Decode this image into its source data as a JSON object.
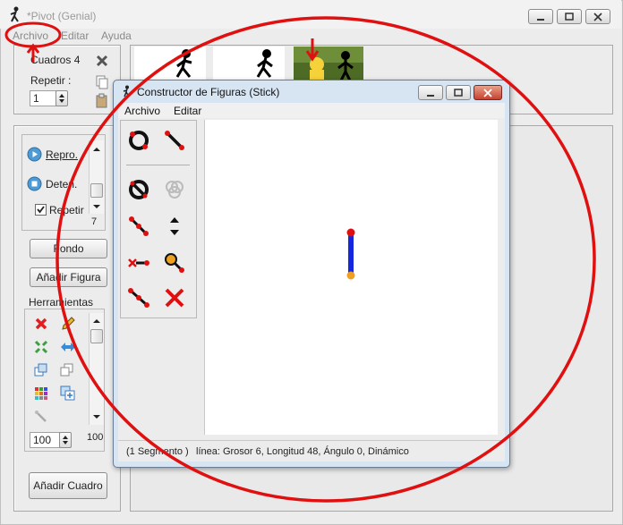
{
  "main_window": {
    "title": "*Pivot (Genial)",
    "menu": [
      "Archivo",
      "Editar",
      "Ayuda"
    ]
  },
  "frames_panel": {
    "cuadros_label": "Cuadros 4",
    "repetir_label": "Repetir :",
    "repetir_value": "1"
  },
  "playback": {
    "play_label": "Repro.",
    "stop_label": "Deten.",
    "loop_label": "Repetir",
    "loop_checked": true,
    "speed_value": "7"
  },
  "buttons": {
    "fondo": "Fondo",
    "anadir_figura": "Añadir Figura",
    "anadir_cuadro": "Añadir Cuadro"
  },
  "tools_panel": {
    "title": "Herramientas",
    "size_value": "100",
    "size_label": "100"
  },
  "dialog": {
    "title": "Constructor de Figuras (Stick)",
    "menu": [
      "Archivo",
      "Editar"
    ],
    "status_segments": "(1 Segmento )",
    "status_line": "línea: Grosor 6, Longitud 48, Ángulo 0, Dinámico"
  },
  "colors": {
    "segment": "#1328e0",
    "joint_red": "#e01010",
    "joint_orange": "#f0a020",
    "annotation": "#e01010"
  }
}
